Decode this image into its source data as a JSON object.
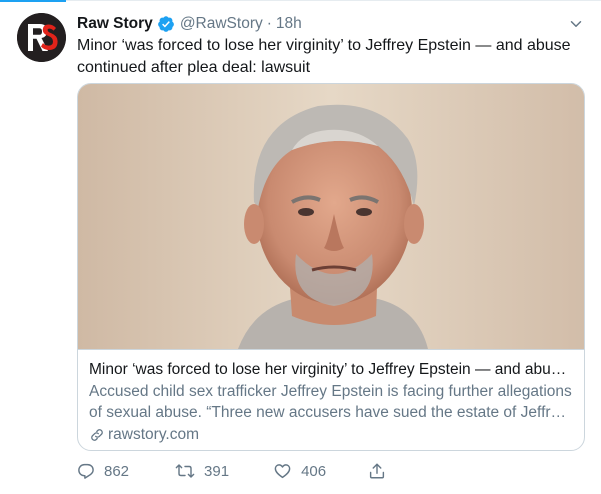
{
  "tweet": {
    "display_name": "Raw Story",
    "handle": "@RawStory",
    "separator": "·",
    "time": "18h",
    "verified": true,
    "avatar_icon": "rawstory-logo-icon",
    "avatar_logo_text": "RS",
    "text": "Minor ‘was forced to lose her virginity’ to Jeffrey Epstein — and abuse continued after plea deal: lawsuit"
  },
  "card": {
    "title": "Minor ‘was forced to lose her virginity’ to Jeffrey Epstein — and abus…",
    "description_line1": "Accused child sex trafficker Jeffrey Epstein is facing further allegations",
    "description_line2": "of sexual abuse. “Three new accusers have sued the estate of Jeffre…",
    "domain": "rawstory.com",
    "image_icon": "article-photo"
  },
  "actions": {
    "replies": "862",
    "retweets": "391",
    "likes": "406"
  },
  "colors": {
    "accent": "#1da1f2",
    "secondary_text": "#657786",
    "primary_text": "#14171a",
    "border": "#ccd6dd",
    "logo_red": "#e2231a"
  }
}
